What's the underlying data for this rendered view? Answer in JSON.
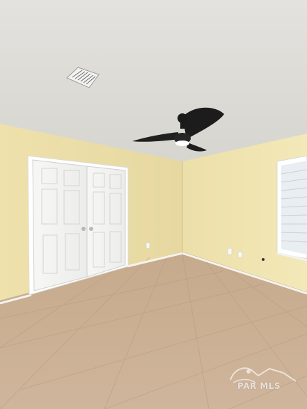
{
  "watermark": {
    "text": "PAR MLS"
  },
  "colors": {
    "ceiling": "#dcdbd6",
    "wall_left": "#ebdda6",
    "wall_right": "#f0e4b2",
    "floor": "#c9ad92",
    "door": "#f4f4f2",
    "fan_blade": "#1e1e1e",
    "window_blind": "#eef1f4"
  }
}
